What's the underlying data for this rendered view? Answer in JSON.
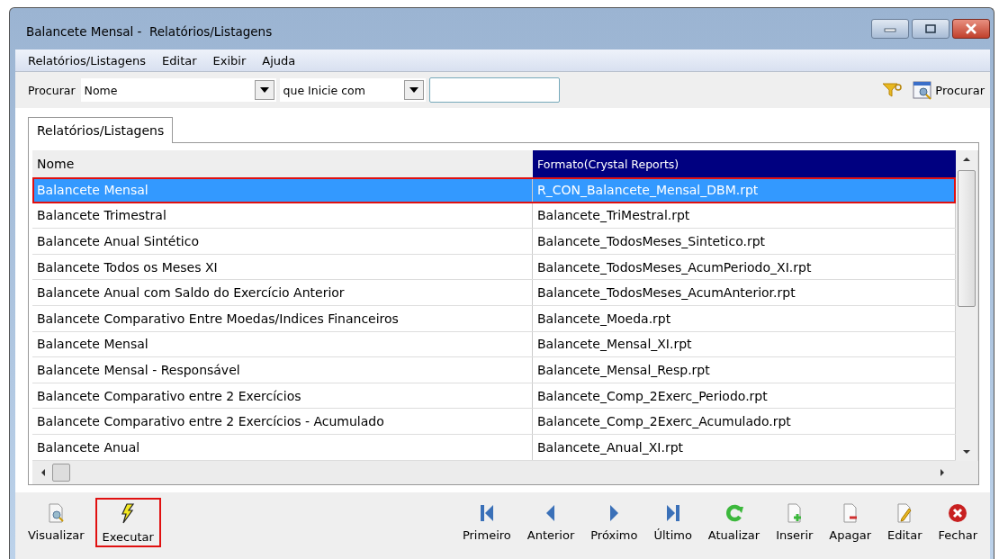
{
  "window": {
    "title": "Balancete Mensal -  Relatórios/Listagens"
  },
  "menu": [
    "Relatórios/Listagens",
    "Editar",
    "Exibir",
    "Ajuda"
  ],
  "search": {
    "label": "Procurar",
    "field": "Nome",
    "condition": "que Inicie com",
    "button": "Procurar"
  },
  "tabs": [
    {
      "label": "Relatórios/Listagens",
      "selected": true
    }
  ],
  "table": {
    "columns": [
      {
        "label": "Nome",
        "selected": false
      },
      {
        "label": "Formato(Crystal Reports)",
        "selected": true
      }
    ],
    "rows": [
      {
        "name": "Balancete Mensal",
        "file": "R_CON_Balancete_Mensal_DBM.rpt",
        "selected": true
      },
      {
        "name": "Balancete Trimestral",
        "file": "Balancete_TriMestral.rpt",
        "selected": false
      },
      {
        "name": "Balancete Anual Sintético",
        "file": "Balancete_TodosMeses_Sintetico.rpt",
        "selected": false
      },
      {
        "name": "Balancete Todos os Meses XI",
        "file": "Balancete_TodosMeses_AcumPeriodo_XI.rpt",
        "selected": false
      },
      {
        "name": "Balancete Anual com Saldo do Exercício Anterior",
        "file": "Balancete_TodosMeses_AcumAnterior.rpt",
        "selected": false
      },
      {
        "name": "Balancete Comparativo Entre Moedas/Indices Financeiros",
        "file": "Balancete_Moeda.rpt",
        "selected": false
      },
      {
        "name": "Balancete Mensal",
        "file": "Balancete_Mensal_XI.rpt",
        "selected": false
      },
      {
        "name": "Balancete Mensal - Responsável",
        "file": "Balancete_Mensal_Resp.rpt",
        "selected": false
      },
      {
        "name": "Balancete Comparativo entre 2 Exercícios",
        "file": "Balancete_Comp_2Exerc_Periodo.rpt",
        "selected": false
      },
      {
        "name": "Balancete Comparativo entre 2 Exercícios - Acumulado",
        "file": "Balancete_Comp_2Exerc_Acumulado.rpt",
        "selected": false
      },
      {
        "name": "Balancete Anual",
        "file": "Balancete_Anual_XI.rpt",
        "selected": false
      }
    ]
  },
  "toolbar_left": [
    {
      "label": "Visualizar",
      "kind": "preview",
      "highlighted": false
    },
    {
      "label": "Executar",
      "kind": "run",
      "highlighted": true
    }
  ],
  "toolbar_right": [
    {
      "label": "Primeiro",
      "kind": "first"
    },
    {
      "label": "Anterior",
      "kind": "prev"
    },
    {
      "label": "Próximo",
      "kind": "next"
    },
    {
      "label": "Último",
      "kind": "last"
    },
    {
      "label": "Atualizar",
      "kind": "refresh"
    },
    {
      "label": "Inserir",
      "kind": "insert"
    },
    {
      "label": "Apagar",
      "kind": "delete"
    },
    {
      "label": "Editar",
      "kind": "edit"
    },
    {
      "label": "Fechar",
      "kind": "close"
    }
  ]
}
